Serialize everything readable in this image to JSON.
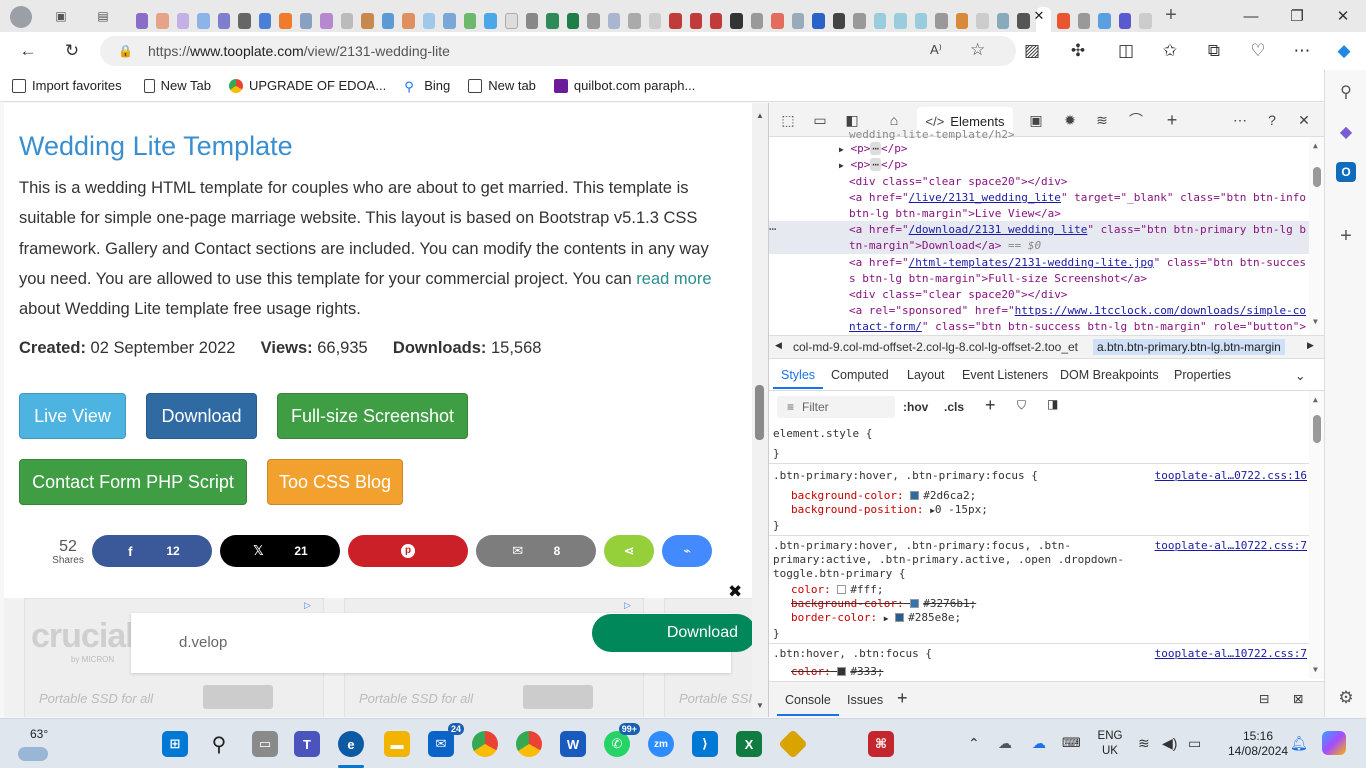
{
  "browser": {
    "address_url_prefix": "https://",
    "address_url_host": "www.tooplate.com",
    "address_url_path": "/view/2131-wedding-lite",
    "favorites": [
      "Import favorites",
      "New Tab",
      "UPGRADE OF EDOA...",
      "Bing",
      "New tab",
      "quilbot.com paraph..."
    ]
  },
  "page": {
    "title": "Wedding Lite Template",
    "description": "This is a wedding HTML template for couples who are about to get married. This template is suitable for simple one-page marriage website. This layout is based on Bootstrap v5.1.3 CSS framework. Gallery and Contact sections are included. You can modify the contents in any way you need. You are allowed to use this template for your commercial project. You can",
    "read_more": "read more",
    "description_tail": "about Wedding Lite template free usage rights.",
    "created_label": "Created:",
    "created_value": "02 September 2022",
    "views_label": "Views:",
    "views_value": "66,935",
    "downloads_label": "Downloads:",
    "downloads_value": "15,568",
    "buttons": {
      "live_view": "Live View",
      "download": "Download",
      "screenshot": "Full-size Screenshot",
      "contact_form": "Contact Form PHP Script",
      "css_blog": "Too CSS Blog"
    },
    "share": {
      "total": "52",
      "shares_label": "Shares",
      "facebook": "12",
      "x": "21",
      "email": "8"
    },
    "ad": {
      "brand": "d.velop",
      "download": "Download",
      "crucial": "crucial",
      "crucial_sub": "by MICRON",
      "card_text_1": "Portable SSD for all",
      "card_text_2": "Portable SSD for all",
      "card_text_3": "Portable SSI"
    }
  },
  "devtools": {
    "elements_tab": "Elements",
    "dom": {
      "l0": "wedding-lite-template/h2>",
      "l1_open": "<p>",
      "l1_close": "</p>",
      "l3": "<div class=\"clear space20\"></div>",
      "l4a": "<a href=\"",
      "l4_href": "/live/2131_wedding_lite",
      "l4b": "\" target=\"_blank\" class=\"btn btn-info",
      "l4c": "btn-lg btn-margin\">Live View</a>",
      "l5a": "<a href=\"",
      "l5_href": "/download/2131 wedding lite",
      "l5b": "\" class=\"btn btn-primary btn-lg b",
      "l5c": "tn-margin\">Download</a>",
      "l5d": "== $0",
      "l6a": "<a href=\"",
      "l6_href": "/html-templates/2131-wedding-lite.jpg",
      "l6b": "\" class=\"btn btn-succes",
      "l6c": "s btn-lg btn-margin\">Full-size Screenshot</a>",
      "l7": "<div class=\"clear space20\"></div>",
      "l8a": "<a rel=\"sponsored\" href=\"",
      "l8_href": "https://www.1tcclock.com/downloads/simple-co",
      "l8b": "ntact-form/",
      "l8c": "\" class=\"btn btn-success btn-lg btn-margin\" role=\"button\">"
    },
    "breadcrumb_1": "col-md-9.col-md-offset-2.col-lg-8.col-lg-offset-2.too_et",
    "breadcrumb_2": "a.btn.btn-primary.btn-lg.btn-margin",
    "subtabs": [
      "Styles",
      "Computed",
      "Layout",
      "Event Listeners",
      "DOM Breakpoints",
      "Properties"
    ],
    "filter_placeholder": "Filter",
    "hov": ":hov",
    "cls": ".cls",
    "rules": {
      "r0": "element.style {",
      "r0c": "}",
      "r1_sel": ".btn-primary:hover, .btn-primary:focus {",
      "r1_src": "tooplate-al…0722.css:16",
      "r1_p1": "background-color:",
      "r1_v1": "#2d6ca2;",
      "r1_p2": "background-position:",
      "r1_v2": "0 -15px;",
      "r1c": "}",
      "r2_sel_a": ".btn-primary:hover, .btn-primary:focus, .btn-",
      "r2_sel_b": "primary:active, .btn-primary.active, .open .dropdown-",
      "r2_sel_c": "toggle.btn-primary {",
      "r2_src": "tooplate-al…10722.css:7",
      "r2_p1": "color:",
      "r2_v1": "#fff;",
      "r2_p2": "background-color:",
      "r2_v2": "#3276b1;",
      "r2_p3": "border-color:",
      "r2_v3": "#285e8e;",
      "r2c": "}",
      "r3_sel": ".btn:hover, .btn:focus {",
      "r3_src": "tooplate-al…10722.css:7",
      "r3_p1": "color:",
      "r3_v1": "#333;"
    },
    "drawer_tabs": [
      "Console",
      "Issues"
    ]
  },
  "taskbar": {
    "temperature": "63°",
    "lang_1": "ENG",
    "lang_2": "UK",
    "time": "15:16",
    "date": "14/08/2024",
    "mail_badge": "24",
    "whatsapp_badge": "99+"
  },
  "colors": {
    "btn_info": "#5bc0de",
    "btn_primary": "#2d6ca2",
    "btn_success": "#43a047",
    "btn_warning": "#f0a030",
    "facebook": "#3b5998",
    "x": "#000000",
    "pinterest": "#cb2027",
    "email": "#7d7d7d",
    "sharethis": "#95d03a",
    "messenger": "#448aff"
  }
}
